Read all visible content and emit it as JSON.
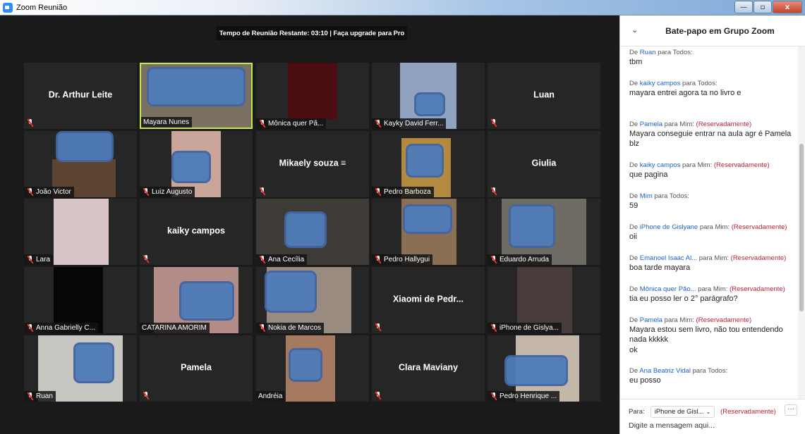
{
  "window": {
    "title": "Zoom Reunião",
    "minimize": "—",
    "maximize": "▫",
    "close": "x"
  },
  "banner": {
    "text": "Tempo de Reunião Restante: 03:10 | Faça upgrade para Pro"
  },
  "tiles": [
    {
      "name": "Dr. Arthur Leite",
      "label": ""
    },
    {
      "name": "",
      "label": "Mayara Nunes"
    },
    {
      "name": "",
      "label": "Mônica quer Pã..."
    },
    {
      "name": "",
      "label": "Kayky David Ferr..."
    },
    {
      "name": "Luan",
      "label": ""
    },
    {
      "name": "",
      "label": "João Victor"
    },
    {
      "name": "",
      "label": "Luiz Augusto"
    },
    {
      "name": "Mikaely souza ≡",
      "label": ""
    },
    {
      "name": "",
      "label": "Pedro Barboza"
    },
    {
      "name": "Giulia",
      "label": ""
    },
    {
      "name": "",
      "label": "Lara"
    },
    {
      "name": "kaiky campos",
      "label": ""
    },
    {
      "name": "",
      "label": "Ana Cecília"
    },
    {
      "name": "",
      "label": "Pedro Hallygui"
    },
    {
      "name": "",
      "label": "Eduardo Arruda"
    },
    {
      "name": "",
      "label": "Anna Gabrielly C..."
    },
    {
      "name": "",
      "label": "CATARINA AMORIM"
    },
    {
      "name": "",
      "label": "Nokia de Marcos"
    },
    {
      "name": "Xiaomi de Pedr...",
      "label": ""
    },
    {
      "name": "",
      "label": "iPhone de Gislya..."
    },
    {
      "name": "",
      "label": "Ruan"
    },
    {
      "name": "Pamela",
      "label": ""
    },
    {
      "name": "",
      "label": "Andréia"
    },
    {
      "name": "Clara Maviany",
      "label": ""
    },
    {
      "name": "",
      "label": "Pedro Henrique ..."
    }
  ],
  "chat": {
    "title": "Bate-papo em Grupo Zoom",
    "collapse_icon": "⌄",
    "messages": [
      {
        "from": "Ruan",
        "to": "Todos",
        "private": "",
        "text": "tbm"
      },
      {
        "from": "kaiky campos",
        "to": "Todos",
        "private": "",
        "text": "mayara entrei agora ta no livro e"
      },
      {
        "from": "Pamela",
        "to": "Mim",
        "private": "(Reservadamente)",
        "text": "Mayara conseguie entrar na aula agr é Pamela blz"
      },
      {
        "from": "kaiky campos",
        "to": "Mim",
        "private": "(Reservadamente)",
        "text": "que pagina"
      },
      {
        "from": "Mim",
        "to": "Todos",
        "private": "",
        "text": "59"
      },
      {
        "from": "iPhone de Gislyane",
        "to": "Mim",
        "private": "(Reservadamente)",
        "text": "oii"
      },
      {
        "from": "Emanoel Isaac Al...",
        "to": "Mim",
        "private": "(Reservadamente)",
        "text": "boa tarde mayara"
      },
      {
        "from": "Mônica quer Pão...",
        "to": "Mim",
        "private": "(Reservadamente)",
        "text": "tia eu posso ler o 2° parágrafo?"
      },
      {
        "from": "Pamela",
        "to": "Mim",
        "private": "(Reservadamente)",
        "text": "Mayara estou sem livro, não tou entendendo nada kkkkk"
      },
      {
        "from": "",
        "to": "",
        "private": "",
        "text": "ok"
      },
      {
        "from": "Ana Beatriz Vidal",
        "to": "Todos",
        "private": "",
        "text": "eu posso"
      }
    ],
    "words": {
      "de": "De",
      "para": "para"
    },
    "composer": {
      "to_label": "Para:",
      "recipient": "iPhone de Gisl...",
      "caret": "⌄",
      "private": "(Reservadamente)",
      "more": "···",
      "placeholder": "Digite a mensagem aqui..."
    }
  }
}
